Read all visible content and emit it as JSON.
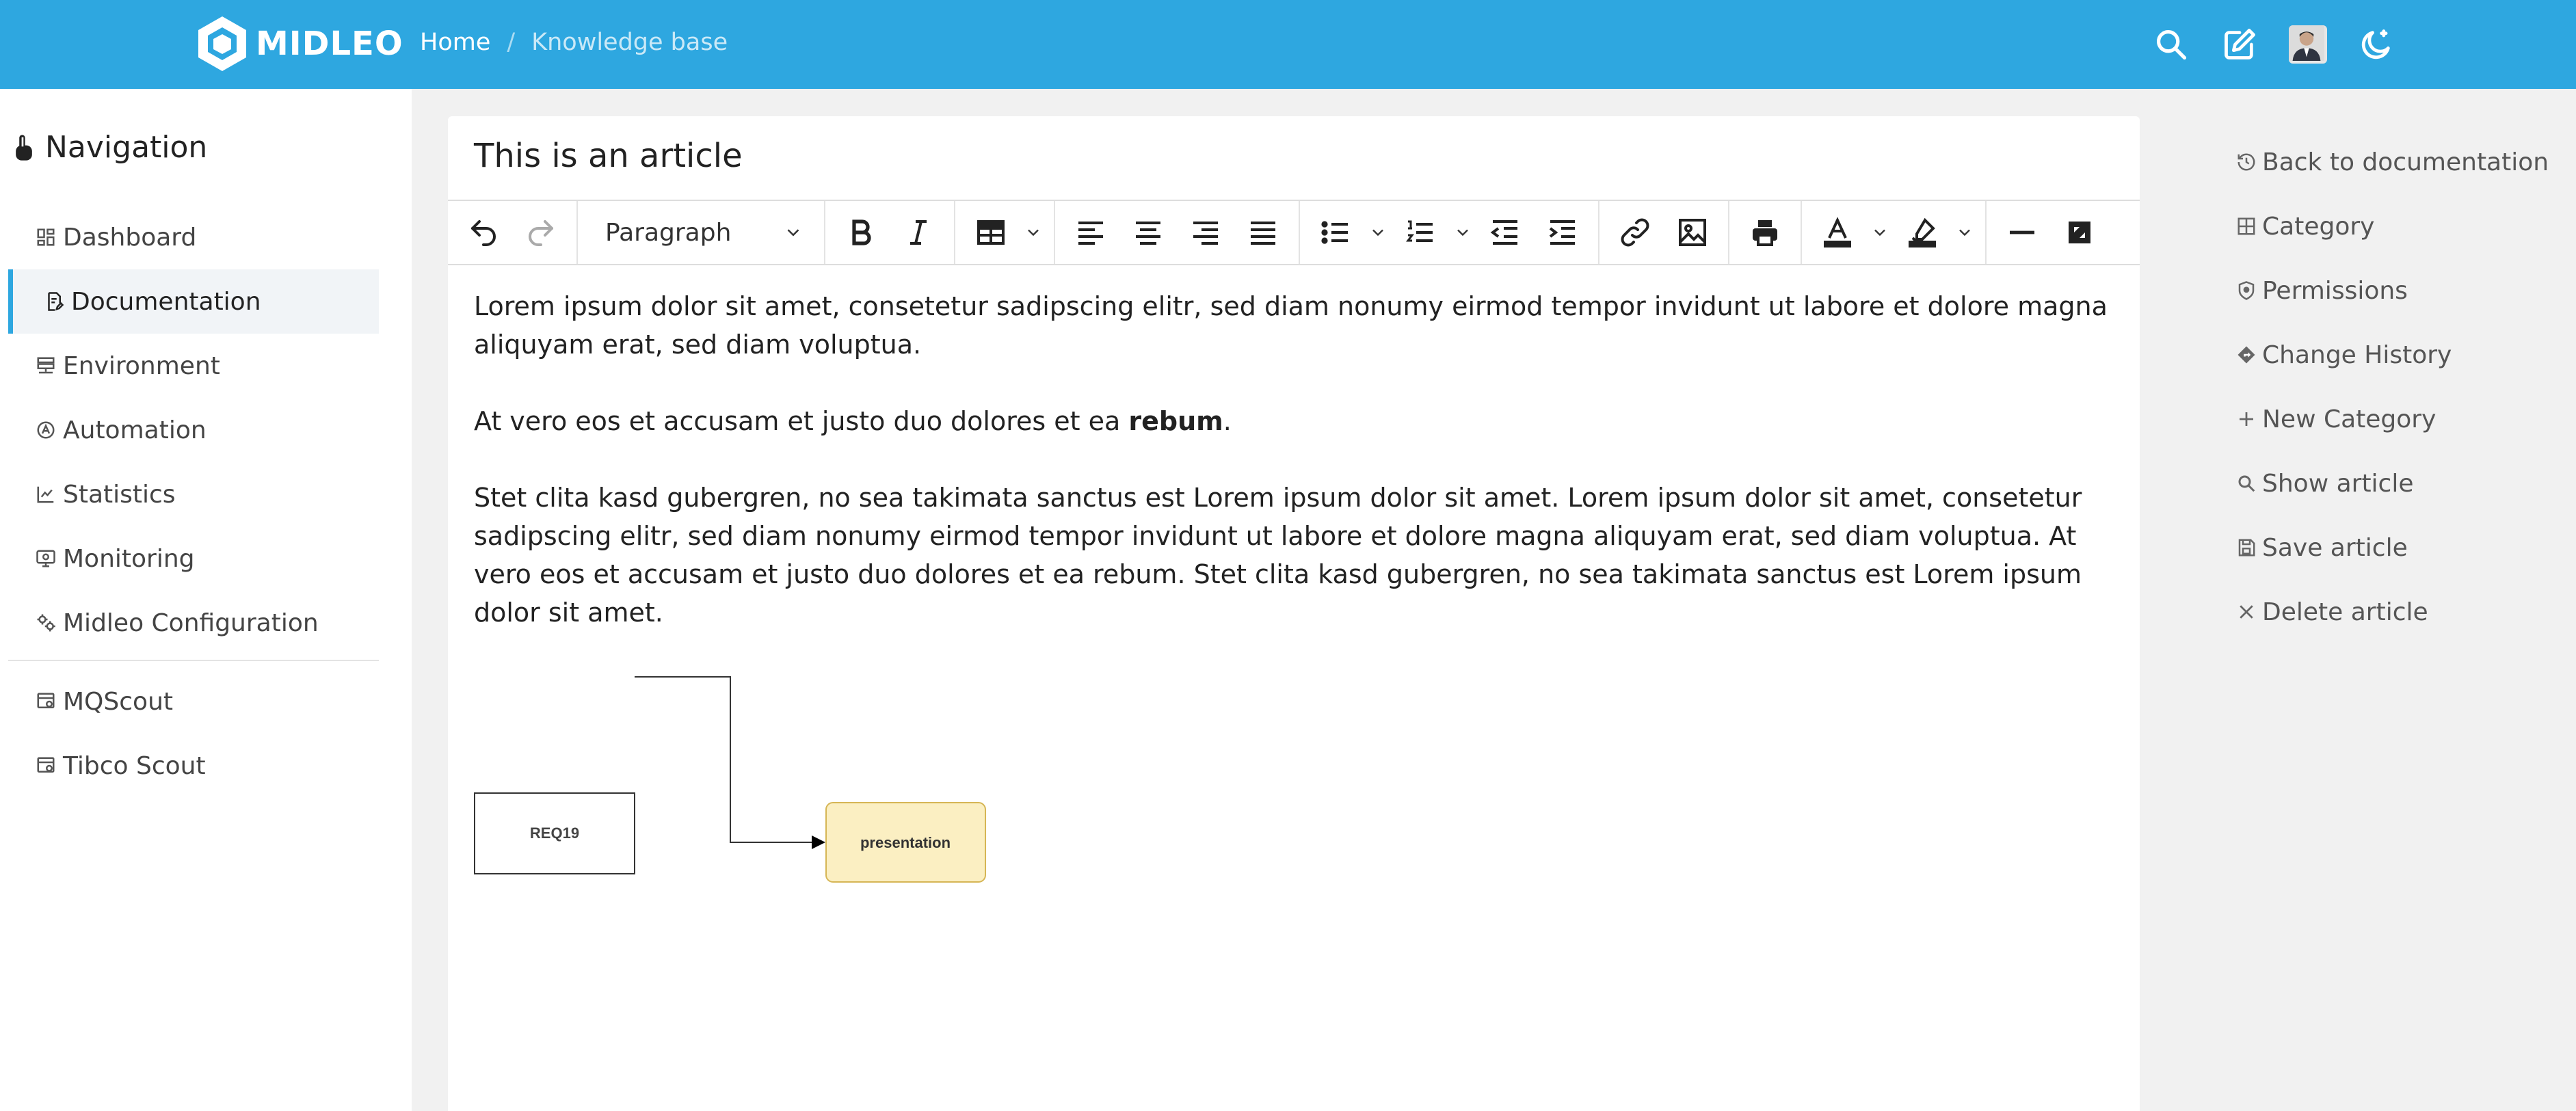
{
  "app": {
    "logo_text": "MIDLEO",
    "brand_color": "#2ea7e0"
  },
  "breadcrumb": {
    "home": "Home",
    "separator": "/",
    "current": "Knowledge base"
  },
  "topbar_icons": [
    "search-icon",
    "edit-icon",
    "avatar",
    "moon-icon"
  ],
  "navigation": {
    "title": "Navigation",
    "items": [
      {
        "label": "Dashboard",
        "icon": "dashboard-icon",
        "active": false
      },
      {
        "label": "Documentation",
        "icon": "document-icon",
        "active": true
      },
      {
        "label": "Environment",
        "icon": "server-icon",
        "active": false
      },
      {
        "label": "Automation",
        "icon": "automation-icon",
        "active": false
      },
      {
        "label": "Statistics",
        "icon": "chart-icon",
        "active": false
      },
      {
        "label": "Monitoring",
        "icon": "monitor-icon",
        "active": false
      },
      {
        "label": "Midleo Configuration",
        "icon": "gears-icon",
        "active": false
      },
      {
        "label": "MQScout",
        "icon": "scout-icon",
        "active": false
      },
      {
        "label": "Tibco Scout",
        "icon": "scout-icon",
        "active": false
      }
    ]
  },
  "editor": {
    "title": "This is an article",
    "block_format": "Paragraph",
    "paragraphs": {
      "p1": "Lorem ipsum dolor sit amet, consetetur sadipscing elitr, sed diam nonumy eirmod tempor invidunt ut labore et dolore magna aliquyam erat, sed diam voluptua.",
      "p2_start": "At vero eos et accusam et justo duo dolores et ea ",
      "p2_bold": "rebum",
      "p2_end": ".",
      "p3": "Stet clita kasd gubergren, no sea takimata sanctus est Lorem ipsum dolor sit amet. Lorem ipsum dolor sit amet, consetetur sadipscing elitr, sed diam nonumy eirmod tempor invidunt ut labore et dolore magna aliquyam erat, sed diam voluptua. At vero eos et accusam et justo duo dolores et ea rebum. Stet clita kasd gubergren, no sea takimata sanctus est Lorem ipsum dolor sit amet."
    },
    "diagram": {
      "node1": "REQ19",
      "node2": "presentation"
    }
  },
  "actions": [
    {
      "label": "Back to documentation",
      "icon": "history-icon"
    },
    {
      "label": "Category",
      "icon": "grid-icon"
    },
    {
      "label": "Permissions",
      "icon": "shield-icon"
    },
    {
      "label": "Change History",
      "icon": "diamond-arrow-icon"
    },
    {
      "label": "New Category",
      "icon": "plus-icon"
    },
    {
      "label": "Show article",
      "icon": "search-icon"
    },
    {
      "label": "Save article",
      "icon": "save-icon"
    },
    {
      "label": "Delete article",
      "icon": "close-icon"
    }
  ]
}
